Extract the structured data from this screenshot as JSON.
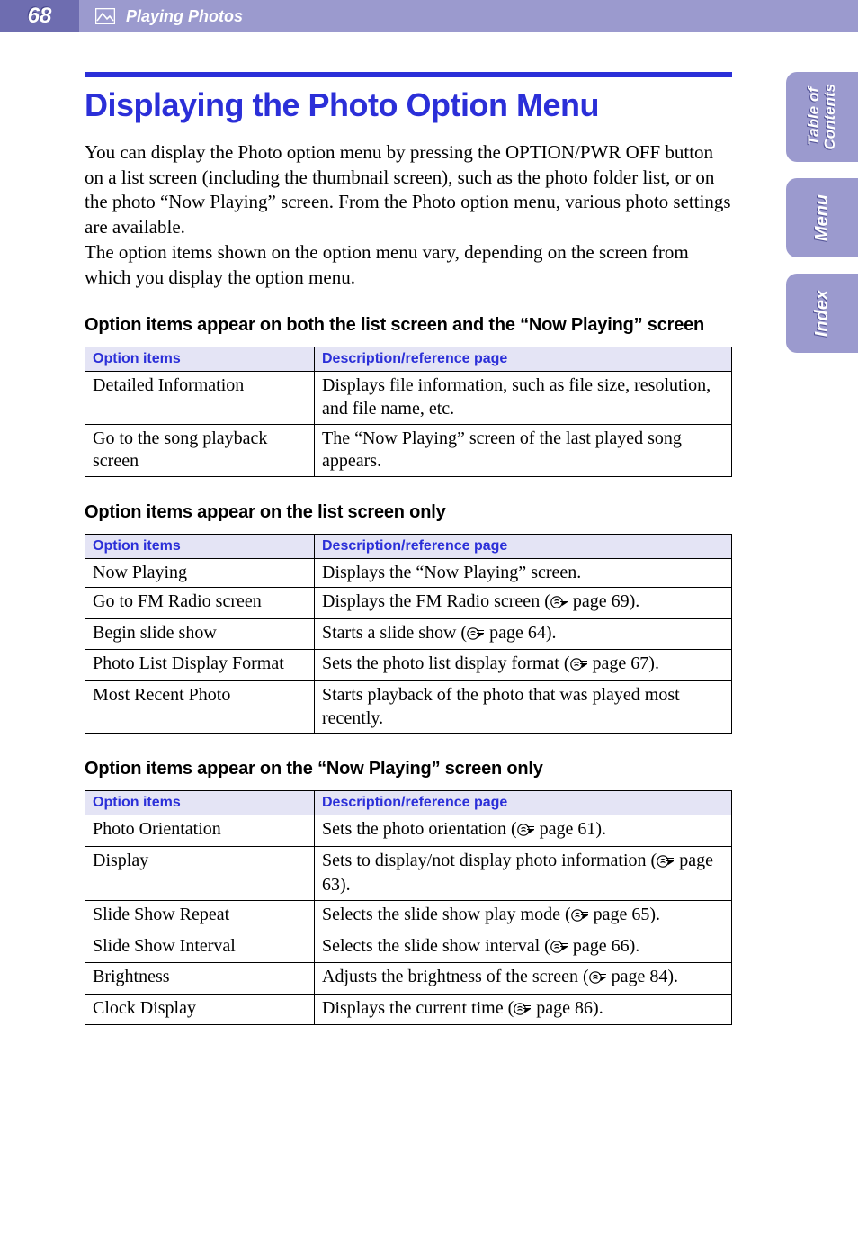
{
  "header": {
    "page_number": "68",
    "section": "Playing Photos"
  },
  "side_tabs": {
    "toc": "Table of\nContents",
    "menu": "Menu",
    "index": "Index"
  },
  "title": "Displaying the Photo Option Menu",
  "intro_p1": "You can display the Photo option menu by pressing the OPTION/PWR OFF button on a list screen (including the thumbnail screen), such as the photo folder list, or on the photo “Now Playing” screen. From the Photo option menu, various photo settings are available.",
  "intro_p2": "The option items shown on the option menu vary, depending on the screen from which you display the option menu.",
  "section_both": {
    "heading": "Option items appear on both the list screen and the “Now Playing” screen",
    "col1": "Option items",
    "col2": "Description/reference page",
    "rows": [
      {
        "item": "Detailed Information",
        "desc": "Displays file information, such as file size, resolution, and file name, etc."
      },
      {
        "item": "Go to the song playback screen",
        "desc": "The “Now Playing” screen of the last played song appears."
      }
    ]
  },
  "section_list": {
    "heading": "Option items appear on the list screen only",
    "col1": "Option items",
    "col2": "Description/reference page",
    "rows": [
      {
        "item": "Now Playing",
        "desc_pre": "Displays the “Now Playing” screen.",
        "page": null
      },
      {
        "item": "Go to FM Radio screen",
        "desc_pre": "Displays the FM Radio screen (",
        "page": "page 69",
        "desc_post": ")."
      },
      {
        "item": "Begin slide show",
        "desc_pre": "Starts a slide show (",
        "page": "page 64",
        "desc_post": ")."
      },
      {
        "item": "Photo List Display Format",
        "desc_pre": "Sets the photo list display format (",
        "page": "page 67",
        "desc_post": ")."
      },
      {
        "item": "Most Recent Photo",
        "desc_pre": "Starts playback of the photo that was played most recently.",
        "page": null
      }
    ]
  },
  "section_now": {
    "heading": "Option items appear on the “Now Playing” screen only",
    "col1": "Option items",
    "col2": "Description/reference page",
    "rows": [
      {
        "item": "Photo Orientation",
        "desc_pre": "Sets the photo orientation (",
        "page": "page 61",
        "desc_post": ")."
      },
      {
        "item": "Display",
        "desc_pre": "Sets to display/not display photo information (",
        "page": "page 63",
        "desc_post": ")."
      },
      {
        "item": "Slide Show Repeat",
        "desc_pre": "Selects the slide show play mode (",
        "page": "page 65",
        "desc_post": ")."
      },
      {
        "item": "Slide Show Interval",
        "desc_pre": "Selects the slide show interval (",
        "page": "page 66",
        "desc_post": ")."
      },
      {
        "item": "Brightness",
        "desc_pre": "Adjusts the brightness of the screen (",
        "page": "page 84",
        "desc_post": ")."
      },
      {
        "item": "Clock Display",
        "desc_pre": "Displays the current time (",
        "page": "page 86",
        "desc_post": ")."
      }
    ]
  }
}
